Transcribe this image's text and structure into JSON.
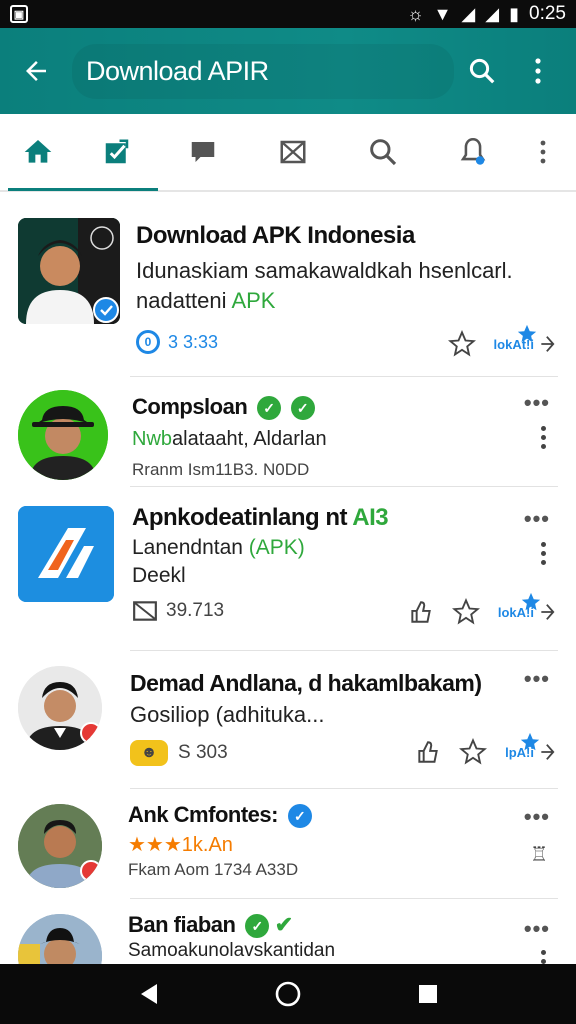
{
  "status": {
    "time": "0:25"
  },
  "appbar": {
    "title": "Download APIR",
    "back_icon": "back-arrow-icon",
    "search_icon": "search-icon",
    "menu_icon": "more-vert-icon",
    "color": "#0b7f7c"
  },
  "tabs": [
    {
      "icon": "home-icon"
    },
    {
      "icon": "edit-check-icon"
    },
    {
      "icon": "chat-icon"
    },
    {
      "icon": "mail-icon"
    },
    {
      "icon": "search-icon"
    },
    {
      "icon": "notification-icon"
    },
    {
      "icon": "more-vert-icon"
    }
  ],
  "items": [
    {
      "name": "Download APK Indonesia",
      "line1": "Idunaskiam samakawaldkah hsenlcarl.",
      "line2_prefix": "nadatteni ",
      "line2_green": "APK",
      "meta_badge": "0",
      "meta": "3 3:33",
      "action_label": "lokAt!i"
    },
    {
      "name": "Compsloan",
      "line1_green": "Nwb",
      "line1": "alataaht, Aldarlan",
      "meta": "Rranm Ism11B3. N0DD"
    },
    {
      "name_prefix": "Apnkodeatinlang nt ",
      "name_green": "AI3",
      "line1_prefix": "Lanendntan ",
      "line1_green": "(APK)",
      "line2": "Deekl",
      "meta": "39.713",
      "action_label": "lokA!i"
    },
    {
      "name": "Demad Andlana, d hakamlbakam)",
      "line1": "Gosiliop (adhituka...",
      "meta": "S 303",
      "action_label": "lpA!i"
    },
    {
      "name": "Ank Cmfontes:",
      "line1": "★★★1k.An",
      "meta": "Fkam Aom 1734 A33D"
    },
    {
      "name": "Ban fiaban",
      "line1": "Samoakunolavskantidan"
    }
  ],
  "navbar": {
    "back": "back-triangle-icon",
    "home": "home-circle-icon",
    "recents": "recents-square-icon"
  }
}
